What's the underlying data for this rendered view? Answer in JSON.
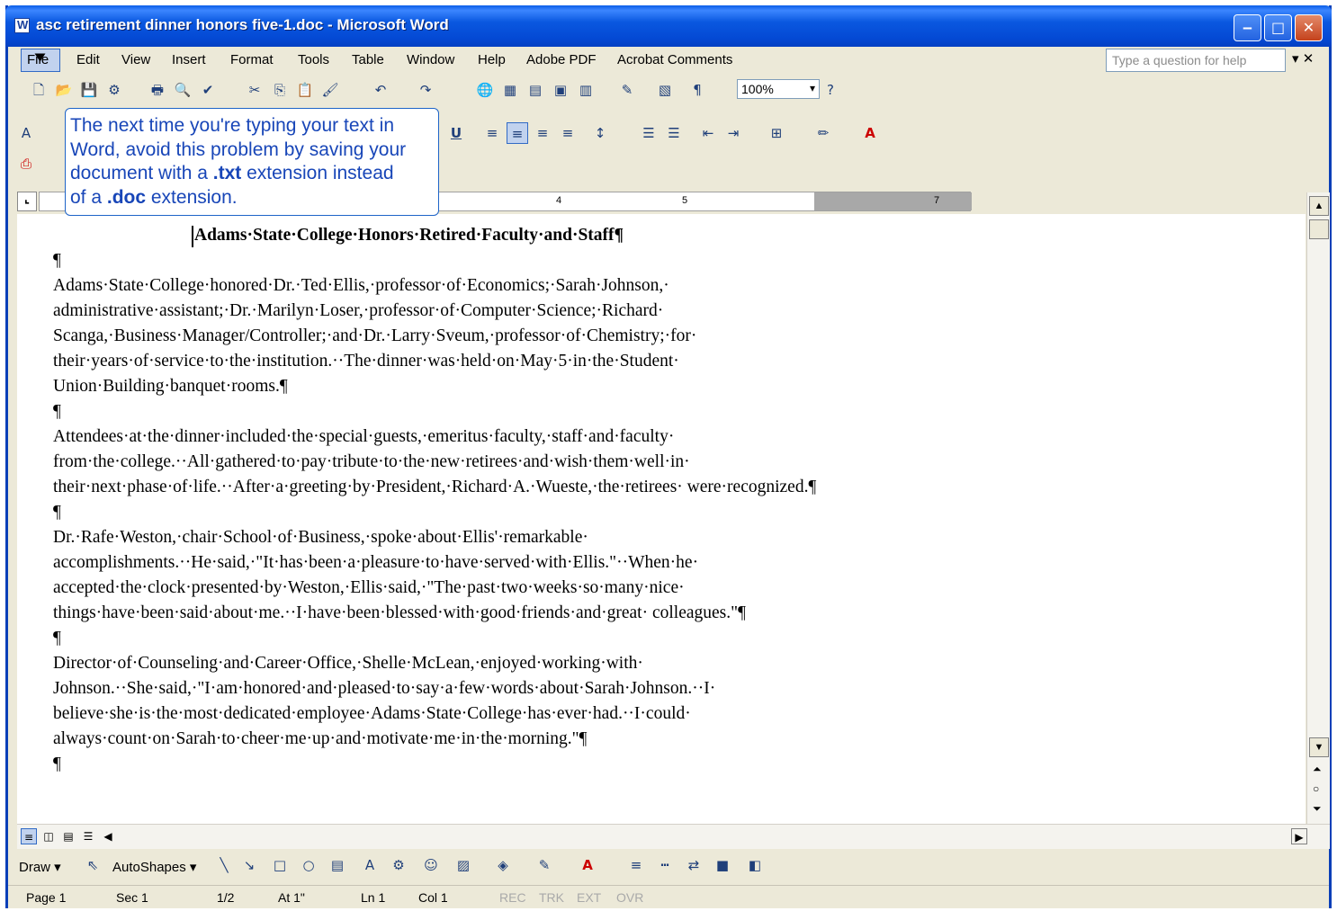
{
  "window": {
    "title": "asc retirement dinner honors five-1.doc - Microsoft Word",
    "buttons": {
      "minimize": "‒",
      "maximize": "□",
      "close": "✕"
    }
  },
  "menubar": {
    "items": [
      "File",
      "Edit",
      "View",
      "Insert",
      "Format",
      "Tools",
      "Table",
      "Window",
      "Help",
      "Adobe PDF",
      "Acrobat Comments"
    ],
    "help_placeholder": "Type a question for help",
    "close_label": "▾ ✕"
  },
  "toolbar": {
    "zoom": "100%"
  },
  "tooltip": {
    "line1": "The next time you're typing your text in",
    "line2": "Word, avoid this problem by saving your",
    "line3a": "document with a ",
    "ext1": ".txt",
    "line3b": " extension instead",
    "line4a": "of a ",
    "ext2": ".doc",
    "line4b": " extension."
  },
  "ruler": {
    "numbers": [
      "4",
      "5",
      "7"
    ]
  },
  "document": {
    "heading": "Adams·State·College·Honors·Retired·Faculty·and·Staff¶",
    "paragraphs": [
      "¶",
      "Adams·State·College·honored·Dr.·Ted·Ellis,·professor·of·Economics;·Sarah·Johnson,· administrative·assistant;·Dr.·Marilyn·Loser,·professor·of·Computer·Science;·Richard· Scanga,·Business·Manager/Controller;·and·Dr.·Larry·Sveum,·professor·of·Chemistry;·for· their·years·of·service·to·the·institution.··The·dinner·was·held·on·May·5·in·the·Student· Union·Building·banquet·rooms.¶",
      "¶",
      "Attendees·at·the·dinner·included·the·special·guests,·emeritus·faculty,·staff·and·faculty· from·the·college.··All·gathered·to·pay·tribute·to·the·new·retirees·and·wish·them·well·in· their·next·phase·of·life.··After·a·greeting·by·President,·Richard·A.·Wueste,·the·retirees· were·recognized.¶",
      "¶",
      "Dr.·Rafe·Weston,·chair·School·of·Business,·spoke·about·Ellis'·remarkable· accomplishments.··He·said,·\"It·has·been·a·pleasure·to·have·served·with·Ellis.\"··When·he· accepted·the·clock·presented·by·Weston,·Ellis·said,·\"The·past·two·weeks·so·many·nice· things·have·been·said·about·me.··I·have·been·blessed·with·good·friends·and·great· colleagues.\"¶",
      "¶",
      "Director·of·Counseling·and·Career·Office,·Shelle·McLean,·enjoyed·working·with· Johnson.··She·said,·\"I·am·honored·and·pleased·to·say·a·few·words·about·Sarah·Johnson.··I· believe·she·is·the·most·dedicated·employee·Adams·State·College·has·ever·had.··I·could· always·count·on·Sarah·to·cheer·me·up·and·motivate·me·in·the·morning.\"¶",
      "¶"
    ]
  },
  "drawbar": {
    "draw": "Draw ▾",
    "autoshapes": "AutoShapes ▾"
  },
  "status": {
    "page": "Page 1",
    "sec": "Sec 1",
    "pages": "1/2",
    "at": "At 1\"",
    "ln": "Ln 1",
    "col": "Col 1",
    "rec": "REC",
    "trk": "TRK",
    "ext": "EXT",
    "ovr": "OVR"
  }
}
